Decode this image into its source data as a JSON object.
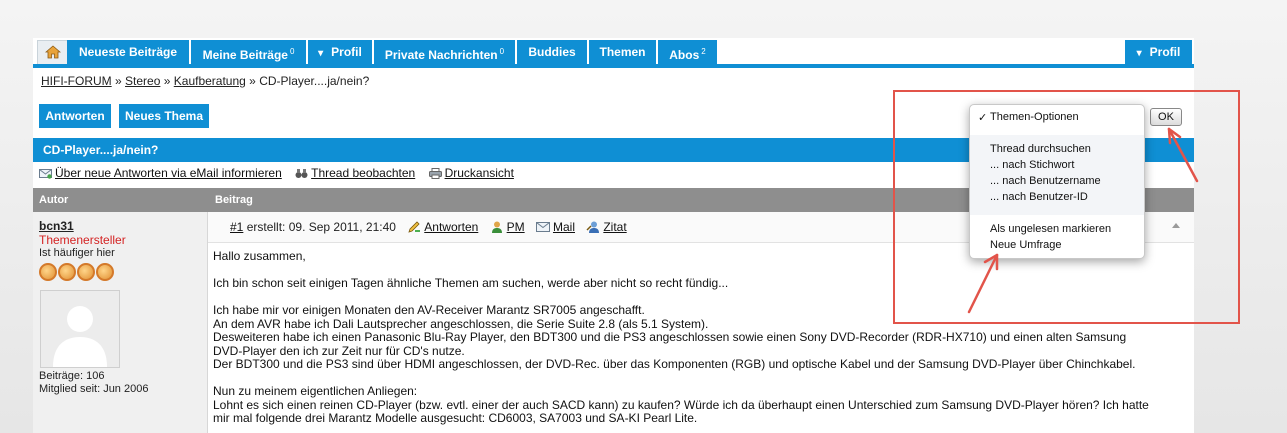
{
  "nav": {
    "tabs": [
      {
        "label": "Neueste Beiträge",
        "sup": ""
      },
      {
        "label": "Meine Beiträge",
        "sup": "0"
      },
      {
        "label": "Profil",
        "sup": ""
      },
      {
        "label": "Private Nachrichten",
        "sup": "0"
      },
      {
        "label": "Buddies",
        "sup": ""
      },
      {
        "label": "Themen",
        "sup": ""
      },
      {
        "label": "Abos",
        "sup": "2"
      }
    ],
    "right_profile": "Profil",
    "dropdown_glyph": "▾"
  },
  "breadcrumb": {
    "items": [
      "HIFI-FORUM",
      "Stereo",
      "Kaufberatung"
    ],
    "separator": "»",
    "current": "CD-Player....ja/nein?"
  },
  "actions": {
    "reply": "Antworten",
    "new_topic": "Neues Thema",
    "ok": "OK"
  },
  "thread": {
    "title": "CD-Player....ja/nein?",
    "tools": [
      "Über neue Antworten via eMail informieren",
      "Thread beobachten",
      "Druckansicht"
    ]
  },
  "columns": {
    "author": "Autor",
    "post": "Beitrag"
  },
  "author": {
    "name": "bcn31",
    "role": "Themenersteller",
    "status": "Ist häufiger hier",
    "posts": "Beiträge: 106",
    "member_since": "Mitglied seit: Jun 2006"
  },
  "post": {
    "number": "#1",
    "created": "erstellt: 09. Sep 2011, 21:40",
    "reply": "Antworten",
    "pm": "PM",
    "mail": "Mail",
    "quote": "Zitat",
    "lines": [
      "Hallo zusammen,",
      "",
      "Ich bin schon seit einigen Tagen ähnliche Themen am suchen, werde aber nicht so recht fündig...",
      "",
      "Ich habe mir vor einigen Monaten den AV-Receiver Marantz SR7005 angeschafft.",
      "An dem AVR habe ich Dali Lautsprecher angeschlossen, die Serie Suite 2.8 (als 5.1 System).",
      "Desweiteren habe ich einen Panasonic Blu-Ray Player, den BDT300 und die PS3 angeschlossen sowie einen Sony DVD-Recorder (RDR-HX710) und einen alten Samsung",
      "DVD-Player den ich zur Zeit nur für CD's nutze.",
      "Der BDT300 und die PS3 sind über HDMI angeschlossen, der DVD-Rec. über das Komponenten (RGB) und optische Kabel und der Samsung DVD-Player über Chinchkabel.",
      "",
      "Nun zu meinem eigentlichen Anliegen:",
      "Lohnt es sich einen reinen CD-Player (bzw. evtl. einer der auch SACD kann) zu kaufen? Würde ich da überhaupt einen Unterschied zum Samsung DVD-Player hören? Ich hatte",
      "mir mal folgende drei Marantz Modelle ausgesucht: CD6003, SA7003 und SA-KI Pearl Lite."
    ]
  },
  "menu": {
    "checkmark": "✓",
    "selected": "Themen-Optionen",
    "search_header": "Thread durchsuchen",
    "by_keyword": "... nach Stichwort",
    "by_username": "... nach Benutzername",
    "by_userid": "... nach Benutzer-ID",
    "mark_unread": "Als ungelesen markieren",
    "new_poll": "Neue Umfrage"
  },
  "colors": {
    "accent": "#0f8fd4",
    "annotation": "#e2544a",
    "header_gray": "#8e8e8e",
    "role_red": "#d42323"
  }
}
